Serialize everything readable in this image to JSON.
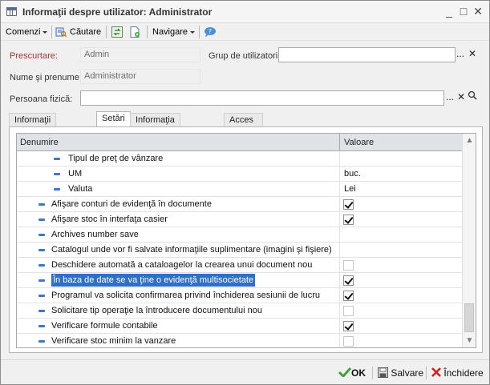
{
  "window": {
    "title": "Informaţii despre utilizator: Administrator",
    "minimize": "_",
    "maximize": "□",
    "close": "✕"
  },
  "toolbar": {
    "commands": "Comenzi",
    "search": "Căutare",
    "navigate": "Navigare"
  },
  "form": {
    "short_label": "Prescurtare:",
    "short_value": "Admin",
    "group_label": "Grup de utilizatori:",
    "group_value": "",
    "fullname_label": "Nume şi prenume:",
    "fullname_value": "Administrator",
    "person_label": "Persoana fizică:",
    "person_value": "",
    "ellipsis": "...",
    "clear": "✕"
  },
  "tabs": [
    {
      "label": "Informaţii generale",
      "active": false
    },
    {
      "label": "Setări",
      "active": true
    },
    {
      "label": "Informaţia de contact",
      "active": false
    },
    {
      "label": "Acces la obiecte",
      "active": false
    }
  ],
  "grid": {
    "col_name": "Denumire",
    "col_value": "Valoare",
    "rows": [
      {
        "name": "Tipul de preţ de vânzare",
        "value": "",
        "type": "text",
        "level": 2
      },
      {
        "name": "UM",
        "value": "buc.",
        "type": "text",
        "level": 2
      },
      {
        "name": "Valuta",
        "value": "Lei",
        "type": "text",
        "level": 2
      },
      {
        "name": "Afişare conturi de evidenţă în documente",
        "value": true,
        "type": "check",
        "level": 1
      },
      {
        "name": "Afişare stoc în interfaţa casier",
        "value": true,
        "type": "check",
        "level": 1
      },
      {
        "name": "Archives number save",
        "value": "",
        "type": "text",
        "level": 1
      },
      {
        "name": "Catalogul unde vor fi salvate informaţiile suplimentare (imagini şi fişiere)",
        "value": "",
        "type": "text",
        "level": 1
      },
      {
        "name": "Deschidere automată a cataloagelor la crearea unui document nou",
        "value": false,
        "type": "check",
        "level": 1
      },
      {
        "name": "În baza de date se va ţine o evidenţă multisocietate",
        "value": true,
        "type": "check",
        "level": 1,
        "selected": true
      },
      {
        "name": "Programul va solicita confirmarea privind închiderea sesiunii de lucru",
        "value": true,
        "type": "check",
        "level": 1
      },
      {
        "name": "Solicitare tip operaţie la întroducere documentului nou",
        "value": false,
        "type": "check",
        "level": 1
      },
      {
        "name": "Verificare formule contabile",
        "value": true,
        "type": "check",
        "level": 1
      },
      {
        "name": "Verificare stoc minim la vanzare",
        "value": false,
        "type": "check",
        "level": 1
      }
    ]
  },
  "bottom": {
    "ok": "OK",
    "save": "Salvare",
    "close": "Închidere"
  },
  "colors": {
    "accent": "#2f6fc6",
    "required_label": "#a83232",
    "ok_icon": "#3aa53a",
    "close_icon": "#cc2222"
  }
}
